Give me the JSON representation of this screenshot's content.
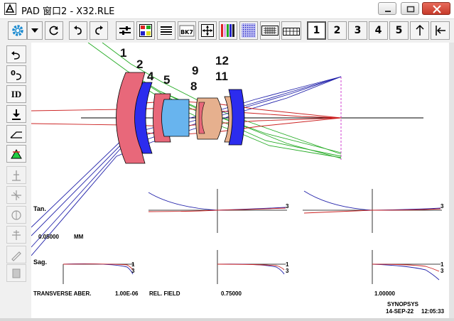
{
  "window": {
    "title": "PAD 窗口2 - X32.RLE"
  },
  "toolbar": {
    "items": [
      {
        "name": "settings-gear-icon"
      },
      {
        "name": "dropdown-arrow-icon"
      },
      {
        "name": "refresh-icon"
      },
      {
        "name": "undo-icon"
      },
      {
        "name": "redo-icon"
      },
      {
        "name": "sliders-icon"
      },
      {
        "name": "color-grid-icon"
      },
      {
        "name": "barcode-icon"
      },
      {
        "name": "glass-label-icon",
        "text": "BK7"
      },
      {
        "name": "expand-arrows-icon"
      },
      {
        "name": "color-bars-icon"
      },
      {
        "name": "dither-pattern-icon"
      },
      {
        "name": "keyboard-icon"
      },
      {
        "name": "table-icon"
      }
    ],
    "pages": [
      "1",
      "2",
      "3",
      "4",
      "5"
    ],
    "active_page": "1"
  },
  "lefttools": [
    {
      "name": "undo-tool-icon",
      "enabled": true
    },
    {
      "name": "zero-undo-tool-icon",
      "text": "0",
      "enabled": true
    },
    {
      "name": "id-tool-icon",
      "text": "ID",
      "enabled": true
    },
    {
      "name": "download-tool-icon",
      "enabled": true
    },
    {
      "name": "pencil-slope-tool-icon",
      "enabled": true
    },
    {
      "name": "green-triangle-tool-icon",
      "enabled": true
    },
    {
      "name": "gripper-tool-icon",
      "enabled": false
    },
    {
      "name": "crosshair-tool-icon",
      "enabled": false
    },
    {
      "name": "circle-tool-icon",
      "enabled": false
    },
    {
      "name": "lens-tool-icon",
      "enabled": false
    },
    {
      "name": "pen-tool-icon",
      "enabled": false
    },
    {
      "name": "page-tool-icon",
      "enabled": false
    }
  ],
  "lens_numbers": [
    "1",
    "2",
    "4",
    "5",
    "9",
    "8",
    "12",
    "11"
  ],
  "plot_labels": {
    "tan": "Tan.",
    "sag": "Sag.",
    "scale_value": "0.05000",
    "scale_unit": "MM",
    "transverse": "TRANSVERSE ABER.",
    "wavelength": "1.00E-06",
    "rel_field": "REL. FIELD",
    "field_075": "0.75000",
    "field_100": "1.00000",
    "company": "SYNOPSYS",
    "date": "14-SEP-22",
    "time": "12:05:33"
  },
  "curve_labels": {
    "tan_1": "3",
    "tan_2": "3",
    "sag_1a": "1",
    "sag_1b": "3",
    "sag_2a": "1",
    "sag_2b": "3",
    "sag_3a": "1",
    "sag_3b": "3"
  },
  "colors": {
    "lens_pink": "#e8687a",
    "lens_blue": "#2c2cee",
    "lens_cyan": "#68b4ee",
    "lens_tan": "#e6b08e",
    "ray_red": "#cc2222",
    "ray_green": "#22aa22",
    "ray_blue": "#2222aa"
  }
}
